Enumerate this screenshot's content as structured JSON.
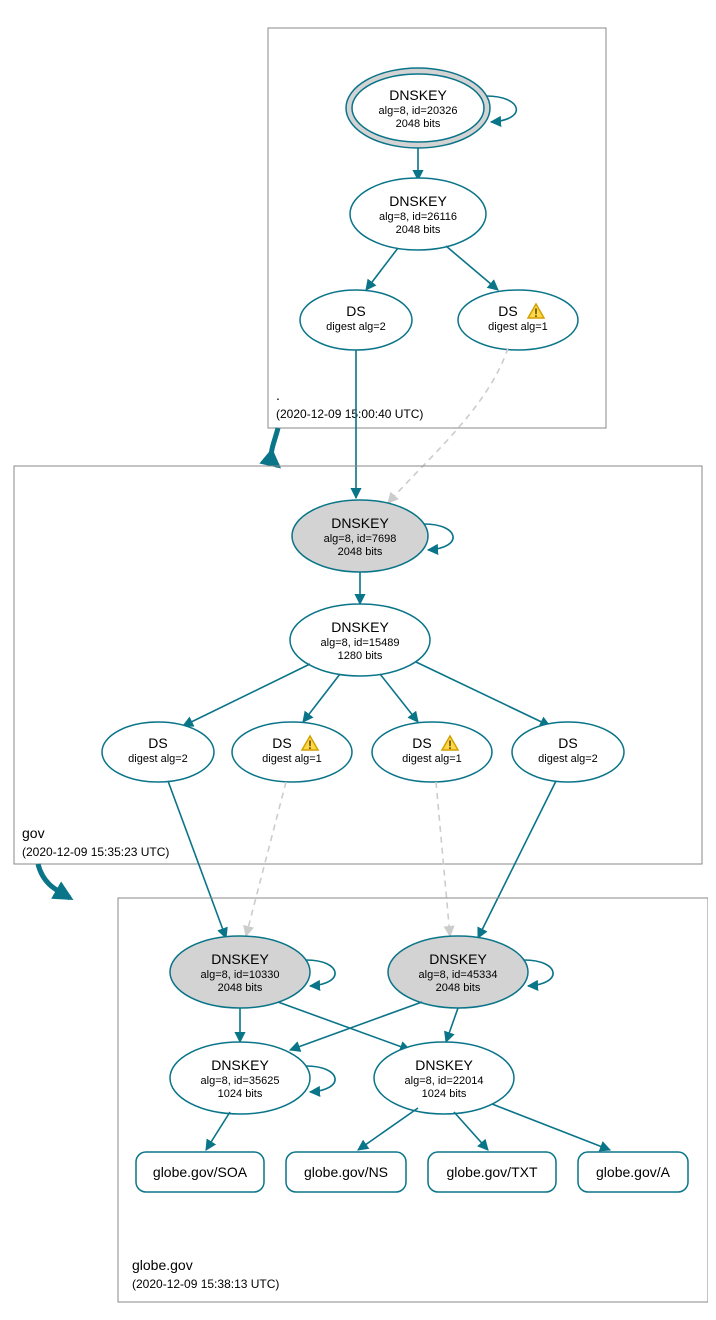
{
  "zones": {
    "root": {
      "label": ".",
      "timestamp": "(2020-12-09 15:00:40 UTC)"
    },
    "gov": {
      "label": "gov",
      "timestamp": "(2020-12-09 15:35:23 UTC)"
    },
    "globe": {
      "label": "globe.gov",
      "timestamp": "(2020-12-09 15:38:13 UTC)"
    }
  },
  "nodes": {
    "root_ksk": {
      "title": "DNSKEY",
      "l1": "alg=8, id=20326",
      "l2": "2048 bits"
    },
    "root_zsk": {
      "title": "DNSKEY",
      "l1": "alg=8, id=26116",
      "l2": "2048 bits"
    },
    "root_ds2": {
      "title": "DS",
      "l1": "digest alg=2"
    },
    "root_ds1": {
      "title": "DS",
      "l1": "digest alg=1"
    },
    "gov_ksk": {
      "title": "DNSKEY",
      "l1": "alg=8, id=7698",
      "l2": "2048 bits"
    },
    "gov_zsk": {
      "title": "DNSKEY",
      "l1": "alg=8, id=15489",
      "l2": "1280 bits"
    },
    "gov_ds_a2": {
      "title": "DS",
      "l1": "digest alg=2"
    },
    "gov_ds_a1": {
      "title": "DS",
      "l1": "digest alg=1"
    },
    "gov_ds_b1": {
      "title": "DS",
      "l1": "digest alg=1"
    },
    "gov_ds_b2": {
      "title": "DS",
      "l1": "digest alg=2"
    },
    "globe_ksk1": {
      "title": "DNSKEY",
      "l1": "alg=8, id=10330",
      "l2": "2048 bits"
    },
    "globe_ksk2": {
      "title": "DNSKEY",
      "l1": "alg=8, id=45334",
      "l2": "2048 bits"
    },
    "globe_zsk1": {
      "title": "DNSKEY",
      "l1": "alg=8, id=35625",
      "l2": "1024 bits"
    },
    "globe_zsk2": {
      "title": "DNSKEY",
      "l1": "alg=8, id=22014",
      "l2": "1024 bits"
    }
  },
  "rr": {
    "soa": "globe.gov/SOA",
    "ns": "globe.gov/NS",
    "txt": "globe.gov/TXT",
    "a": "globe.gov/A"
  },
  "icons": {
    "warning": "⚠"
  }
}
